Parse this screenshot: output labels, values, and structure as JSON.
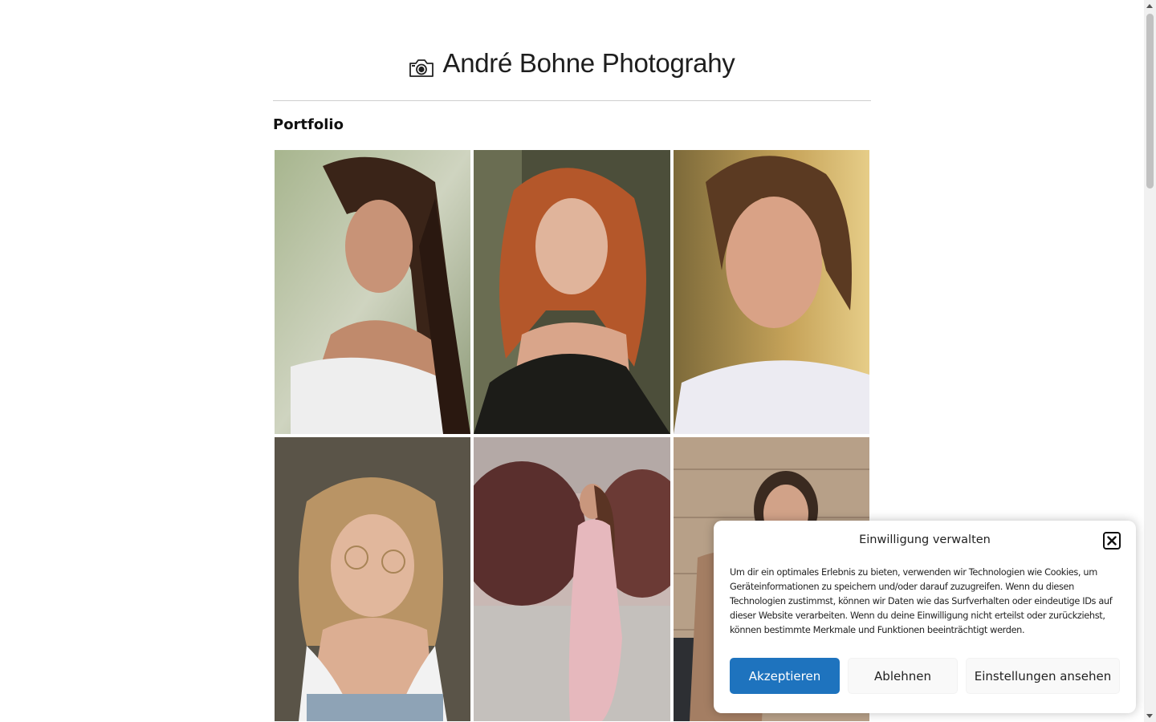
{
  "header": {
    "camera_icon": "camera-icon",
    "site_title": "André Bohne Photograhy"
  },
  "main": {
    "section_title": "Portfolio",
    "gallery": [
      {
        "subject": "woman-long-brown-hair-eyes-closed"
      },
      {
        "subject": "woman-red-hair-black-top"
      },
      {
        "subject": "woman-ponytail-white-shirt"
      },
      {
        "subject": "woman-blonde-glasses"
      },
      {
        "subject": "woman-pink-dress-street"
      },
      {
        "subject": "woman-stone-wall"
      }
    ]
  },
  "consent": {
    "title": "Einwilligung verwalten",
    "close_icon": "close-icon",
    "text": "Um dir ein optimales Erlebnis zu bieten, verwenden wir Technologien wie Cookies, um Geräteinformationen zu speichern und/oder darauf zuzugreifen. Wenn du diesen Technologien zustimmst, können wir Daten wie das Surfverhalten oder eindeutige IDs auf dieser Website verarbeiten. Wenn du deine Einwilligung nicht erteilst oder zurückziehst, können bestimmte Merkmale und Funktionen beeinträchtigt werden.",
    "accept_label": "Akzeptieren",
    "deny_label": "Ablehnen",
    "settings_label": "Einstellungen ansehen",
    "accent_color": "#1e73be"
  }
}
